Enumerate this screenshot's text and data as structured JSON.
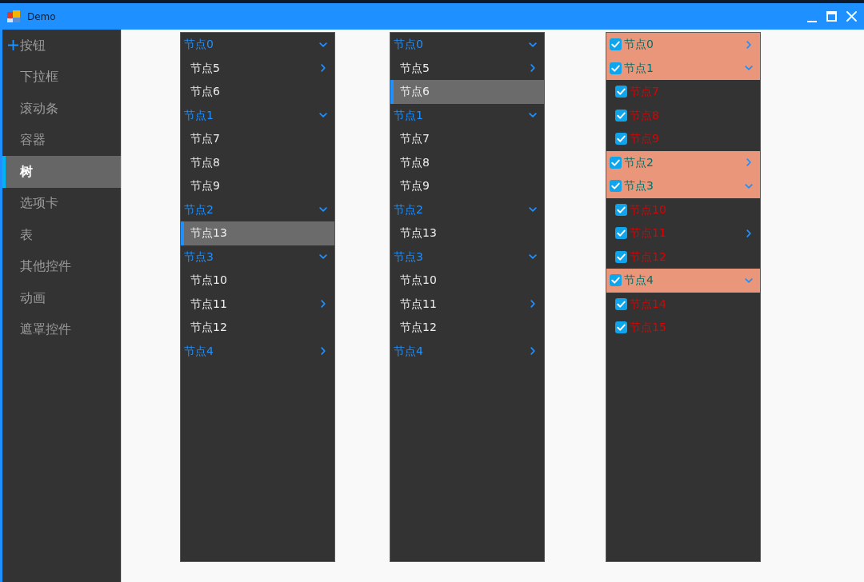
{
  "window": {
    "title": "Demo"
  },
  "sidebar": {
    "items": [
      {
        "label": "按钮",
        "kind": "group",
        "selected": false
      },
      {
        "label": "下拉框",
        "kind": "item",
        "selected": false
      },
      {
        "label": "滚动条",
        "kind": "item",
        "selected": false
      },
      {
        "label": "容器",
        "kind": "item",
        "selected": false
      },
      {
        "label": "树",
        "kind": "item",
        "selected": true
      },
      {
        "label": "选项卡",
        "kind": "item",
        "selected": false
      },
      {
        "label": "表",
        "kind": "item",
        "selected": false
      },
      {
        "label": "其他控件",
        "kind": "item",
        "selected": false
      },
      {
        "label": "动画",
        "kind": "item",
        "selected": false
      },
      {
        "label": "遮罩控件",
        "kind": "item",
        "selected": false
      }
    ]
  },
  "trees": [
    {
      "kind": "plain",
      "nodes": [
        {
          "label": "节点0",
          "kind": "branch",
          "expanded": true,
          "selected": false,
          "children": [
            {
              "label": "节点5",
              "kind": "branch",
              "expanded": false,
              "selected": false
            },
            {
              "label": "节点6",
              "kind": "leaf",
              "selected": false
            }
          ]
        },
        {
          "label": "节点1",
          "kind": "branch",
          "expanded": true,
          "selected": false,
          "children": [
            {
              "label": "节点7",
              "kind": "leaf",
              "selected": false
            },
            {
              "label": "节点8",
              "kind": "leaf",
              "selected": false
            },
            {
              "label": "节点9",
              "kind": "leaf",
              "selected": false
            }
          ]
        },
        {
          "label": "节点2",
          "kind": "branch",
          "expanded": true,
          "selected": false,
          "children": [
            {
              "label": "节点13",
              "kind": "leaf",
              "selected": true
            }
          ]
        },
        {
          "label": "节点3",
          "kind": "branch",
          "expanded": true,
          "selected": false,
          "children": [
            {
              "label": "节点10",
              "kind": "leaf",
              "selected": false
            },
            {
              "label": "节点11",
              "kind": "branch",
              "expanded": false,
              "selected": false
            },
            {
              "label": "节点12",
              "kind": "leaf",
              "selected": false
            }
          ]
        },
        {
          "label": "节点4",
          "kind": "branch",
          "expanded": false,
          "selected": false
        }
      ]
    },
    {
      "kind": "plain",
      "nodes": [
        {
          "label": "节点0",
          "kind": "branch",
          "expanded": true,
          "selected": false,
          "children": [
            {
              "label": "节点5",
              "kind": "branch",
              "expanded": false,
              "selected": false
            },
            {
              "label": "节点6",
              "kind": "leaf",
              "selected": true
            }
          ]
        },
        {
          "label": "节点1",
          "kind": "branch",
          "expanded": true,
          "selected": false,
          "children": [
            {
              "label": "节点7",
              "kind": "leaf",
              "selected": false
            },
            {
              "label": "节点8",
              "kind": "leaf",
              "selected": false
            },
            {
              "label": "节点9",
              "kind": "leaf",
              "selected": false
            }
          ]
        },
        {
          "label": "节点2",
          "kind": "branch",
          "expanded": true,
          "selected": false,
          "children": [
            {
              "label": "节点13",
              "kind": "leaf",
              "selected": false
            }
          ]
        },
        {
          "label": "节点3",
          "kind": "branch",
          "expanded": true,
          "selected": false,
          "children": [
            {
              "label": "节点10",
              "kind": "leaf",
              "selected": false
            },
            {
              "label": "节点11",
              "kind": "branch",
              "expanded": false,
              "selected": false
            },
            {
              "label": "节点12",
              "kind": "leaf",
              "selected": false
            }
          ]
        },
        {
          "label": "节点4",
          "kind": "branch",
          "expanded": false,
          "selected": false
        }
      ]
    },
    {
      "kind": "checkbox",
      "nodes": [
        {
          "label": "节点0",
          "kind": "branch",
          "expanded": false,
          "checked": true,
          "selected": false
        },
        {
          "label": "节点1",
          "kind": "branch",
          "expanded": true,
          "checked": true,
          "selected": false,
          "children": [
            {
              "label": "节点7",
              "kind": "leaf",
              "checked": true,
              "selected": false
            },
            {
              "label": "节点8",
              "kind": "leaf",
              "checked": true,
              "selected": false
            },
            {
              "label": "节点9",
              "kind": "leaf",
              "checked": true,
              "selected": false
            }
          ]
        },
        {
          "label": "节点2",
          "kind": "branch",
          "expanded": false,
          "checked": true,
          "selected": false
        },
        {
          "label": "节点3",
          "kind": "branch",
          "expanded": true,
          "checked": true,
          "selected": false,
          "children": [
            {
              "label": "节点10",
              "kind": "leaf",
              "checked": true,
              "selected": false
            },
            {
              "label": "节点11",
              "kind": "branch",
              "expanded": false,
              "checked": true,
              "selected": false
            },
            {
              "label": "节点12",
              "kind": "leaf",
              "checked": true,
              "selected": false
            }
          ]
        },
        {
          "label": "节点4",
          "kind": "branch",
          "expanded": true,
          "checked": true,
          "selected": false,
          "children": [
            {
              "label": "节点14",
              "kind": "leaf",
              "checked": true,
              "selected": false
            },
            {
              "label": "节点15",
              "kind": "leaf",
              "checked": true,
              "selected": false
            }
          ]
        }
      ]
    }
  ]
}
